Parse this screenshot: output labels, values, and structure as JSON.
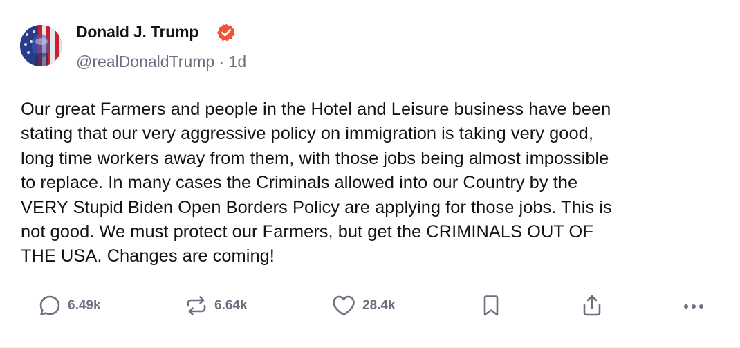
{
  "post": {
    "author": {
      "display_name": "Donald J. Trump",
      "handle": "@realDonaldTrump",
      "separator": "·",
      "age": "1d",
      "verified_icon": "verified-badge-icon",
      "verified_color": "#f0533a"
    },
    "text_lines": [
      "Our great Farmers and people in the Hotel and Leisure business have been",
      "stating that our very aggressive policy on immigration is taking very good,",
      "long time workers away from them, with those jobs being almost impossible",
      "to replace. In many cases the Criminals allowed into our Country by the",
      "VERY Stupid Biden Open Borders Policy are applying for those jobs. This is",
      "not good. We must protect our Farmers, but get the CRIMINALS OUT OF",
      "THE USA. Changes are coming!"
    ],
    "actions": {
      "reply": {
        "icon": "reply-bubble-icon",
        "count": "6.49k"
      },
      "retruth": {
        "icon": "retruth-arrows-icon",
        "count": "6.64k"
      },
      "like": {
        "icon": "heart-icon",
        "count": "28.4k"
      },
      "bookmark": {
        "icon": "bookmark-icon"
      },
      "share": {
        "icon": "share-icon"
      },
      "more": {
        "icon": "more-dots-icon"
      }
    }
  },
  "colors": {
    "text": "#111318",
    "muted": "#6b7080",
    "accent": "#f0533a"
  }
}
